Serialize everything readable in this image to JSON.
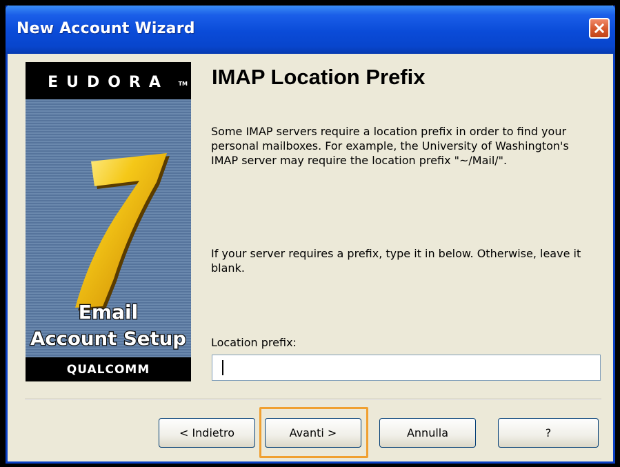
{
  "window": {
    "title": "New Account Wizard",
    "close_icon": "close-icon",
    "close_color": "#d85a30",
    "titlebar_color": "#0a4bd8"
  },
  "logo": {
    "brand": "EUDORA",
    "tm": "TM",
    "version": "7",
    "line1": "Email",
    "line2": "Account Setup",
    "company": "QUALCOMM",
    "version_color": "#f5c020"
  },
  "content": {
    "heading": "IMAP Location Prefix",
    "paragraph1": "Some IMAP servers require a location prefix in order to find your personal mailboxes. For example, the University of Washington's IMAP server may require the location prefix \"~/Mail/\".",
    "paragraph2": "If your server requires a prefix, type it in below. Otherwise, leave it blank.",
    "field_label": "Location prefix:",
    "field_value": ""
  },
  "buttons": {
    "back": "< Indietro",
    "next": "Avanti >",
    "cancel": "Annulla",
    "help": "?",
    "highlight_color": "#f0a030"
  }
}
